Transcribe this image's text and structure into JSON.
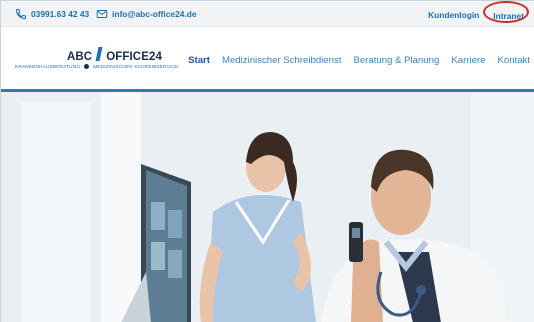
{
  "topbar": {
    "phone": "03991.63 42 43",
    "email": "info@abc-office24.de",
    "kundenlogin": "Kundenlogin",
    "intranet": "Intranet"
  },
  "logo": {
    "main_left": "ABC",
    "main_right": "OFFICE24",
    "sub_left": "KRANKENHAUSBERATUNG",
    "sub_right": "MEDIZINISCHER SCHREIBSERVICE"
  },
  "nav": {
    "items": [
      {
        "label": "Start",
        "active": true
      },
      {
        "label": "Medizinischer Schreibdienst"
      },
      {
        "label": "Beratung & Planung"
      },
      {
        "label": "Karriere"
      },
      {
        "label": "Kontakt"
      }
    ]
  },
  "colors": {
    "accent": "#1f6fb6",
    "highlight_circle": "#d22a2a",
    "header_rule": "#2f79bf"
  },
  "icons": {
    "phone": "phone-icon",
    "email": "mail-icon"
  }
}
